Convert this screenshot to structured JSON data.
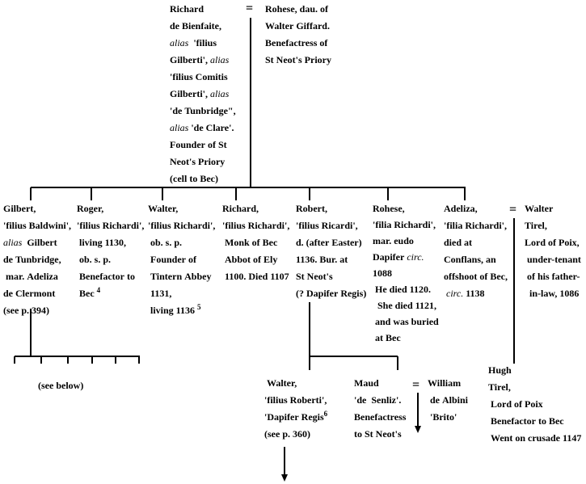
{
  "diagram": {
    "type": "family-tree",
    "marriage_symbol": "=",
    "root": {
      "husband": {
        "lines": [
          [
            {
              "t": "Richard"
            }
          ],
          [
            {
              "t": "de Bienfaite,"
            }
          ],
          [
            {
              "t": "alias",
              "i": true
            },
            {
              "t": "  'filius"
            }
          ],
          [
            {
              "t": "Gilberti', "
            },
            {
              "t": "alias",
              "i": true
            }
          ],
          [
            {
              "t": "'filius Comitis"
            }
          ],
          [
            {
              "t": "Gilberti', "
            },
            {
              "t": "alias",
              "i": true
            }
          ],
          [
            {
              "t": "'de Tunbridge\","
            }
          ],
          [
            {
              "t": "alias",
              "i": true
            },
            {
              "t": " 'de Clare'."
            }
          ],
          [
            {
              "t": "Founder of St"
            }
          ],
          [
            {
              "t": "Neot's Priory"
            }
          ],
          [
            {
              "t": "(cell to Bec)"
            }
          ]
        ]
      },
      "wife": {
        "lines": [
          [
            {
              "t": "Rohese, dau. of"
            }
          ],
          [
            {
              "t": "Walter Giffard."
            }
          ],
          [
            {
              "t": "Benefactress of"
            }
          ],
          [
            {
              "t": "St Neot's Priory"
            }
          ]
        ]
      }
    },
    "children": [
      {
        "id": "gilbert",
        "lines": [
          [
            {
              "t": "Gilbert,"
            }
          ],
          [
            {
              "t": "'filius Baldwini',"
            }
          ],
          [
            {
              "t": "alias",
              "i": true
            },
            {
              "t": "  Gilbert"
            }
          ],
          [
            {
              "t": "de Tunbridge,"
            }
          ],
          [
            {
              "t": " mar. Adeliza"
            }
          ],
          [
            {
              "t": "de Clermont"
            }
          ],
          [
            {
              "t": "(see p. 394)"
            }
          ]
        ]
      },
      {
        "id": "roger",
        "lines": [
          [
            {
              "t": "Roger,"
            }
          ],
          [
            {
              "t": "'filius Richardi',"
            }
          ],
          [
            {
              "t": " living 1130,"
            }
          ],
          [
            {
              "t": " ob. s. p."
            }
          ],
          [
            {
              "t": " Benefactor to"
            }
          ],
          [
            {
              "t": " Bec "
            },
            {
              "t": "4",
              "sup": true
            }
          ]
        ]
      },
      {
        "id": "walter",
        "lines": [
          [
            {
              "t": "Walter,"
            }
          ],
          [
            {
              "t": "'filius Richardi',"
            }
          ],
          [
            {
              "t": " ob. s. p."
            }
          ],
          [
            {
              "t": " Founder of"
            }
          ],
          [
            {
              "t": " Tintern Abbey"
            }
          ],
          [
            {
              "t": " 1131,"
            }
          ],
          [
            {
              "t": " living 1136 "
            },
            {
              "t": "5",
              "sup": true
            }
          ]
        ]
      },
      {
        "id": "richard",
        "lines": [
          [
            {
              "t": "Richard,"
            }
          ],
          [
            {
              "t": "'filius Richardi',"
            }
          ],
          [
            {
              "t": " Monk of Bec"
            }
          ],
          [
            {
              "t": " Abbot of Ely"
            }
          ],
          [
            {
              "t": " 1100. Died 1107"
            }
          ]
        ]
      },
      {
        "id": "robert",
        "lines": [
          [
            {
              "t": "Robert,"
            }
          ],
          [
            {
              "t": "'filius Ricardi',"
            }
          ],
          [
            {
              "t": "d. (after Easter)"
            }
          ],
          [
            {
              "t": "1136. Bur. at"
            }
          ],
          [
            {
              "t": "St Neot's"
            }
          ],
          [
            {
              "t": "(? Dapifer Regis)"
            }
          ]
        ]
      },
      {
        "id": "rohese",
        "lines": [
          [
            {
              "t": "Rohese,"
            }
          ],
          [
            {
              "t": "'filia Richardi',"
            }
          ],
          [
            {
              "t": "mar. eudo"
            }
          ],
          [
            {
              "t": "Dapifer "
            },
            {
              "t": "circ.",
              "i": true
            }
          ],
          [
            {
              "t": "1088"
            }
          ],
          [
            {
              "t": " He died 1120."
            }
          ],
          [
            {
              "t": "  She died 1121,"
            }
          ],
          [
            {
              "t": " and was buried"
            }
          ],
          [
            {
              "t": " at Bec"
            }
          ]
        ]
      },
      {
        "id": "adeliza",
        "lines": [
          [
            {
              "t": "Adeliza,"
            }
          ],
          [
            {
              "t": "'filia Richardi',"
            }
          ],
          [
            {
              "t": "died at"
            }
          ],
          [
            {
              "t": "Conflans, an"
            }
          ],
          [
            {
              "t": "offshoot of Bec,"
            }
          ],
          [
            {
              "t": " circ.",
              "i": true
            },
            {
              "t": " 1138"
            }
          ]
        ]
      }
    ],
    "spouses": {
      "walter_tirel": {
        "lines": [
          [
            {
              "t": "Walter"
            }
          ],
          [
            {
              "t": "Tirel,"
            }
          ],
          [
            {
              "t": "Lord of Poix,"
            }
          ],
          [
            {
              "t": " under-tenant"
            }
          ],
          [
            {
              "t": " of his father-"
            }
          ],
          [
            {
              "t": "  in-law, 1086"
            }
          ]
        ]
      },
      "william_de_albini": {
        "lines": [
          [
            {
              "t": "William"
            }
          ],
          [
            {
              "t": " de Albini"
            }
          ],
          [
            {
              "t": " 'Brito'"
            }
          ]
        ]
      }
    },
    "grandchildren": {
      "gilbert_children_note": "(see below)",
      "robert_children": [
        {
          "id": "walter-son-of-robert",
          "lines": [
            [
              {
                "t": " Walter,"
              }
            ],
            [
              {
                "t": "'filius Roberti',"
              }
            ],
            [
              {
                "t": "'Dapifer Regis"
              },
              {
                "t": "6",
                "sup": true
              }
            ],
            [
              {
                "t": "(see p. 360)"
              }
            ]
          ]
        },
        {
          "id": "maud",
          "lines": [
            [
              {
                "t": "Maud"
              }
            ],
            [
              {
                "t": "'de  Senliz'."
              }
            ],
            [
              {
                "t": "Benefactress"
              }
            ],
            [
              {
                "t": "to St Neot's"
              }
            ]
          ]
        }
      ],
      "adeliza_son": {
        "id": "hugh-tirel",
        "lines": [
          [
            {
              "t": "Hugh"
            }
          ],
          [
            {
              "t": "Tirel,"
            }
          ],
          [
            {
              "t": " Lord of Poix"
            }
          ],
          [
            {
              "t": " Benefactor to Bec"
            }
          ],
          [
            {
              "t": " Went on crusade 1147"
            }
          ]
        ]
      }
    }
  }
}
